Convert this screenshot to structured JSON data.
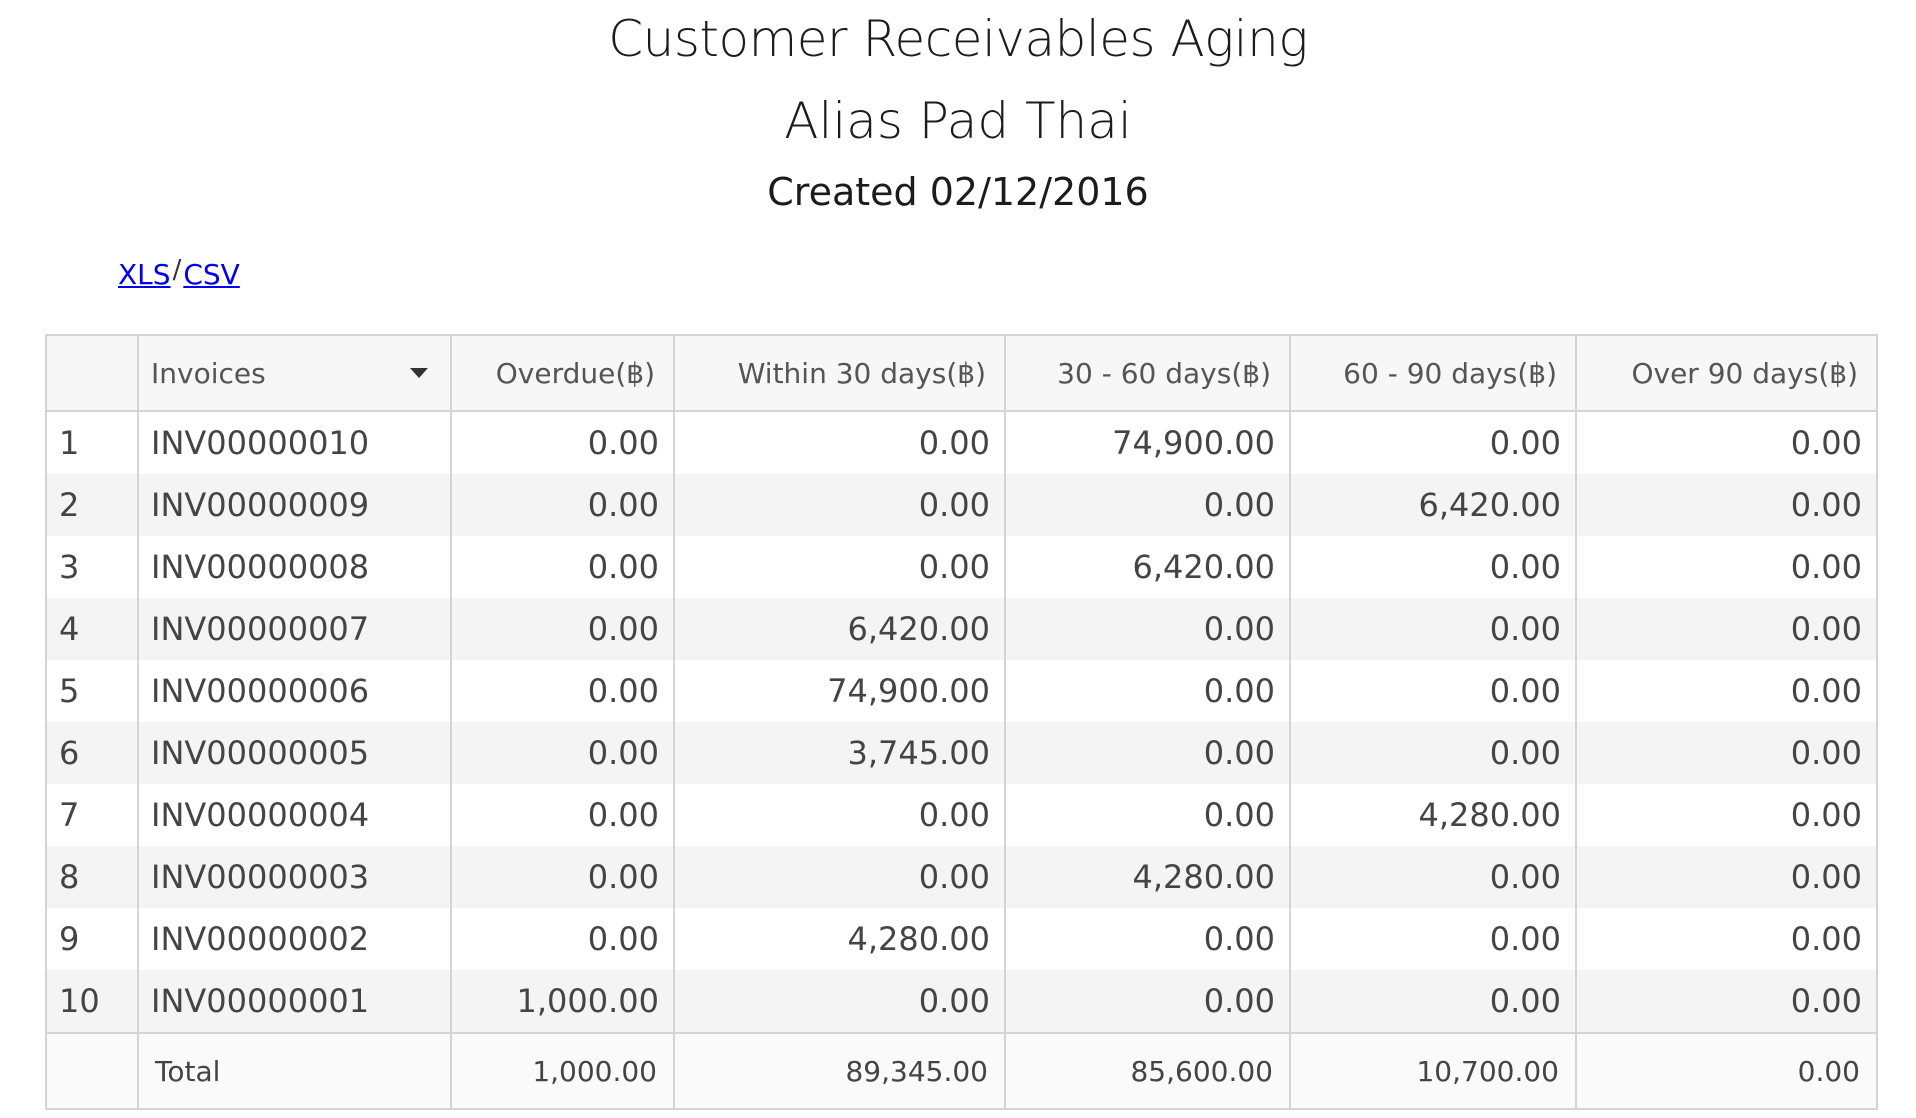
{
  "report": {
    "title": "Customer Receivables Aging",
    "company": "Alias Pad Thai",
    "created": "Created 02/12/2016"
  },
  "exports": {
    "xls": "XLS",
    "separator": "/",
    "csv": "CSV"
  },
  "table": {
    "headers": {
      "number": "",
      "invoices": "Invoices",
      "overdue": "Overdue(฿)",
      "within30": "Within 30 days(฿)",
      "d30_60": "30 - 60 days(฿)",
      "d60_90": "60 - 90 days(฿)",
      "over90": "Over 90 days(฿)"
    },
    "rows": [
      {
        "num": "1",
        "invoice": "INV00000010",
        "overdue": "0.00",
        "within30": "0.00",
        "d30_60": "74,900.00",
        "d60_90": "0.00",
        "over90": "0.00"
      },
      {
        "num": "2",
        "invoice": "INV00000009",
        "overdue": "0.00",
        "within30": "0.00",
        "d30_60": "0.00",
        "d60_90": "6,420.00",
        "over90": "0.00"
      },
      {
        "num": "3",
        "invoice": "INV00000008",
        "overdue": "0.00",
        "within30": "0.00",
        "d30_60": "6,420.00",
        "d60_90": "0.00",
        "over90": "0.00"
      },
      {
        "num": "4",
        "invoice": "INV00000007",
        "overdue": "0.00",
        "within30": "6,420.00",
        "d30_60": "0.00",
        "d60_90": "0.00",
        "over90": "0.00"
      },
      {
        "num": "5",
        "invoice": "INV00000006",
        "overdue": "0.00",
        "within30": "74,900.00",
        "d30_60": "0.00",
        "d60_90": "0.00",
        "over90": "0.00"
      },
      {
        "num": "6",
        "invoice": "INV00000005",
        "overdue": "0.00",
        "within30": "3,745.00",
        "d30_60": "0.00",
        "d60_90": "0.00",
        "over90": "0.00"
      },
      {
        "num": "7",
        "invoice": "INV00000004",
        "overdue": "0.00",
        "within30": "0.00",
        "d30_60": "0.00",
        "d60_90": "4,280.00",
        "over90": "0.00"
      },
      {
        "num": "8",
        "invoice": "INV00000003",
        "overdue": "0.00",
        "within30": "0.00",
        "d30_60": "4,280.00",
        "d60_90": "0.00",
        "over90": "0.00"
      },
      {
        "num": "9",
        "invoice": "INV00000002",
        "overdue": "0.00",
        "within30": "4,280.00",
        "d30_60": "0.00",
        "d60_90": "0.00",
        "over90": "0.00"
      },
      {
        "num": "10",
        "invoice": "INV00000001",
        "overdue": "1,000.00",
        "within30": "0.00",
        "d30_60": "0.00",
        "d60_90": "0.00",
        "over90": "0.00"
      }
    ],
    "total": {
      "label": "Total",
      "overdue": "1,000.00",
      "within30": "89,345.00",
      "d30_60": "85,600.00",
      "d60_90": "10,700.00",
      "over90": "0.00"
    }
  }
}
